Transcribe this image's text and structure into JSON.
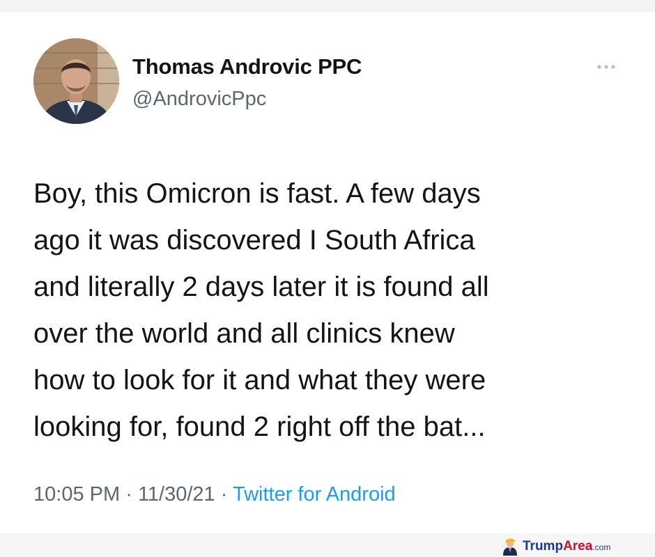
{
  "tweet": {
    "author": {
      "display_name": "Thomas Androvic PPC",
      "handle": "@AndrovicPpc"
    },
    "text_lines": [
      "Boy, this Omicron is fast. A few days",
      "ago it was discovered I South Africa",
      "and literally 2 days later it is found all",
      "over the world and all clinics knew",
      "how to look for it and what they were",
      "looking for, found 2 right off the bat..."
    ],
    "time": "10:05 PM",
    "date": "11/30/21",
    "separator": "·",
    "source": "Twitter for Android",
    "more_icon": "ellipsis-icon"
  },
  "watermark": {
    "brand_main": "Trump",
    "brand_accent": "Area",
    "brand_tld": ".com"
  },
  "colors": {
    "text_primary": "#141414",
    "text_secondary": "#5b6770",
    "link": "#1d9bf0",
    "watermark_blue": "#1b3a8f",
    "watermark_red": "#c8102e"
  }
}
